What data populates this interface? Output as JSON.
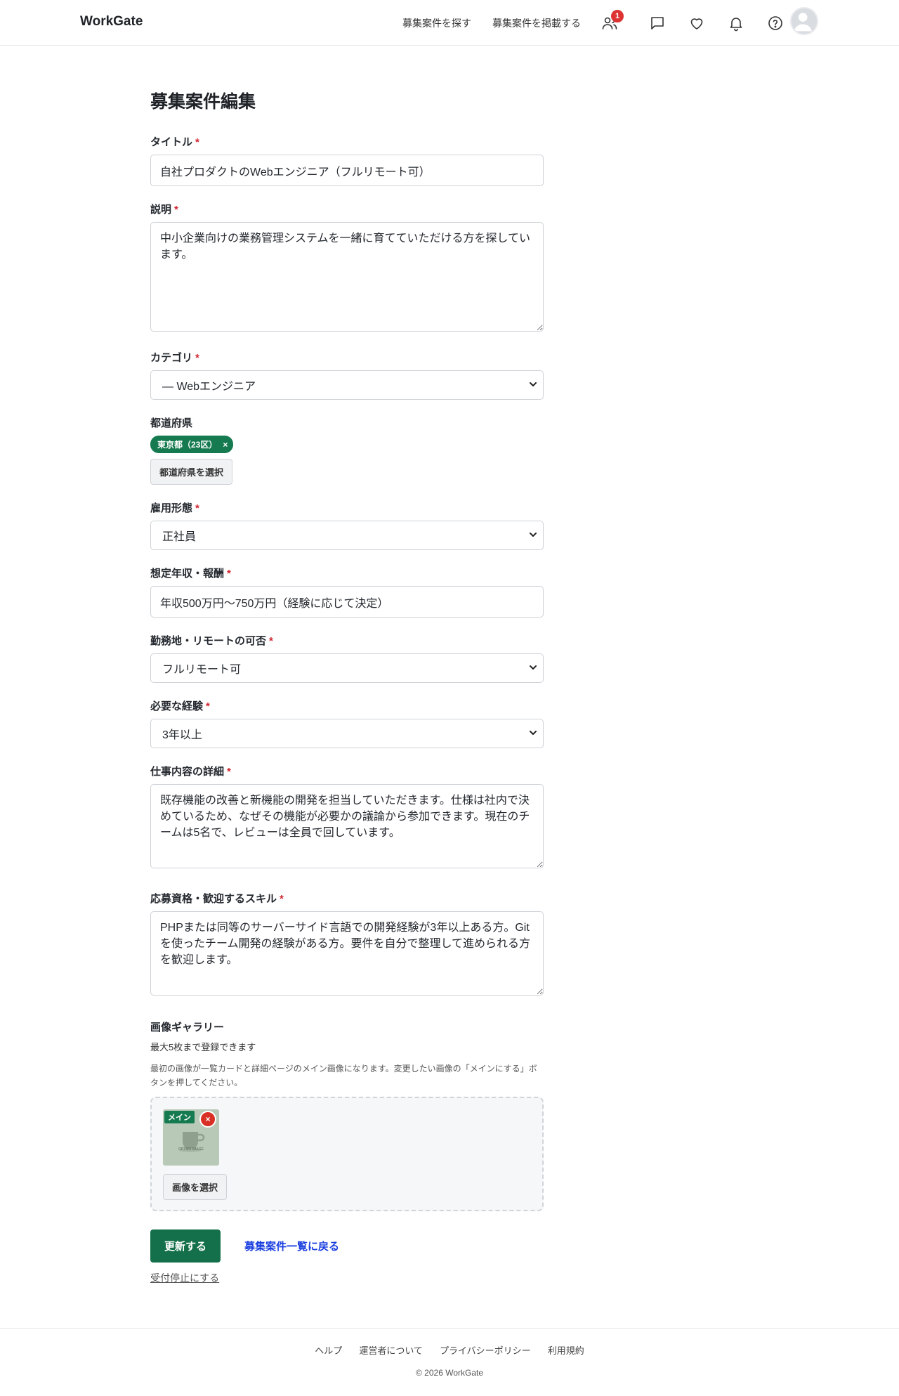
{
  "header": {
    "logo": "WorkGate",
    "nav": [
      "募集案件を探す",
      "募集案件を掲載する"
    ],
    "badge_count": "1"
  },
  "form": {
    "page_title": "募集案件編集",
    "title_label": "タイトル",
    "title_value": "自社プロダクトのWebエンジニア（フルリモート可）",
    "description_label": "説明",
    "description_value": "中小企業向けの業務管理システムを一緒に育てていただける方を探しています。",
    "category_label": "カテゴリ",
    "category_value": "— Webエンジニア",
    "prefecture_label": "都道府県",
    "prefecture_chip": "東京都（23区）",
    "prefecture_chip_remove": "×",
    "prefecture_button": "都道府県を選択",
    "employment_label": "雇用形態",
    "employment_value": "正社員",
    "salary_label": "想定年収・報酬",
    "salary_value": "年収500万円〜750万円（経験に応じて決定）",
    "location_label": "勤務地・リモートの可否",
    "location_value": "フルリモート可",
    "experience_label": "必要な経験",
    "experience_value": "3年以上",
    "job_detail_label": "仕事内容の詳細",
    "job_detail_value": "既存機能の改善と新機能の開発を担当していただきます。仕様は社内で決めているため、なぜその機能が必要かの議論から参加できます。現在のチームは5名で、レビューは全員で回しています。",
    "skills_label": "応募資格・歓迎するスキル",
    "skills_value": "PHPまたは同等のサーバーサイド言語での開発経験が3年以上ある方。Gitを使ったチーム開発の経験がある方。要件を自分で整理して進められる方を歓迎します。",
    "required_mark": "*"
  },
  "gallery": {
    "label": "画像ギャラリー",
    "note": "最大5枚まで登録できます",
    "help": "最初の画像が一覧カードと詳細ページのメイン画像になります。変更したい画像の「メインにする」ボタンを押してください。",
    "main_tag": "メイン",
    "remove": "×",
    "thumb_caption": "OPTMO IMAGE",
    "select_button": "画像を選択"
  },
  "actions": {
    "submit": "更新する",
    "back": "募集案件一覧に戻る",
    "stop": "受付停止にする"
  },
  "footer": {
    "links": [
      "ヘルプ",
      "運営者について",
      "プライバシーポリシー",
      "利用規約"
    ],
    "copyright": "© 2026 WorkGate"
  },
  "colors": {
    "primary": "#14704a",
    "chip": "#157a4f",
    "link": "#1a3fe0",
    "required": "#d1242f",
    "badge": "#dd3333"
  }
}
